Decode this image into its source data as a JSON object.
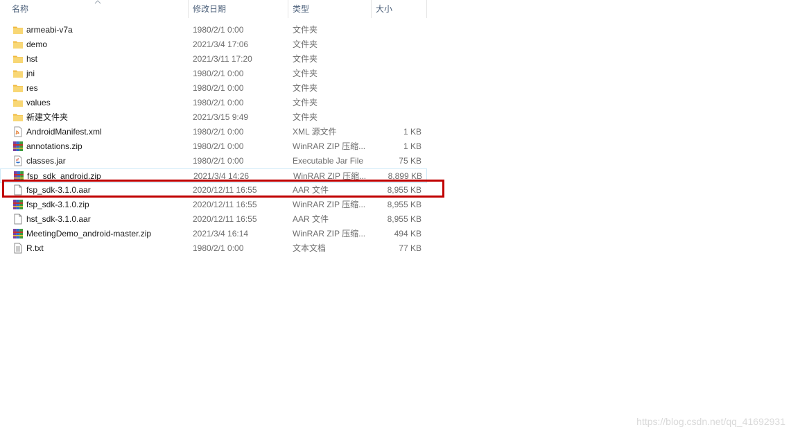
{
  "columns": {
    "name": "名称",
    "date": "修改日期",
    "type": "类型",
    "size": "大小"
  },
  "files": [
    {
      "icon": "folder-icon",
      "name": "armeabi-v7a",
      "date": "1980/2/1 0:00",
      "type": "文件夹",
      "size": ""
    },
    {
      "icon": "folder-icon",
      "name": "demo",
      "date": "2021/3/4 17:06",
      "type": "文件夹",
      "size": ""
    },
    {
      "icon": "folder-icon",
      "name": "hst",
      "date": "2021/3/11 17:20",
      "type": "文件夹",
      "size": ""
    },
    {
      "icon": "folder-icon",
      "name": "jni",
      "date": "1980/2/1 0:00",
      "type": "文件夹",
      "size": ""
    },
    {
      "icon": "folder-icon",
      "name": "res",
      "date": "1980/2/1 0:00",
      "type": "文件夹",
      "size": ""
    },
    {
      "icon": "folder-icon",
      "name": "values",
      "date": "1980/2/1 0:00",
      "type": "文件夹",
      "size": ""
    },
    {
      "icon": "folder-icon",
      "name": "新建文件夹",
      "date": "2021/3/15 9:49",
      "type": "文件夹",
      "size": ""
    },
    {
      "icon": "xml-file-icon",
      "name": "AndroidManifest.xml",
      "date": "1980/2/1 0:00",
      "type": "XML 源文件",
      "size": "1 KB"
    },
    {
      "icon": "winrar-archive-icon",
      "name": "annotations.zip",
      "date": "1980/2/1 0:00",
      "type": "WinRAR ZIP 压缩...",
      "size": "1 KB"
    },
    {
      "icon": "jar-file-icon",
      "name": "classes.jar",
      "date": "1980/2/1 0:00",
      "type": "Executable Jar File",
      "size": "75 KB"
    },
    {
      "icon": "winrar-archive-icon",
      "name": "fsp_sdk_android.zip",
      "date": "2021/3/4 14:26",
      "type": "WinRAR ZIP 压缩...",
      "size": "8,899 KB"
    },
    {
      "icon": "blank-file-icon",
      "name": "fsp_sdk-3.1.0.aar",
      "date": "2020/12/11 16:55",
      "type": "AAR 文件",
      "size": "8,955 KB"
    },
    {
      "icon": "winrar-archive-icon",
      "name": "fsp_sdk-3.1.0.zip",
      "date": "2020/12/11 16:55",
      "type": "WinRAR ZIP 压缩...",
      "size": "8,955 KB"
    },
    {
      "icon": "blank-file-icon",
      "name": "hst_sdk-3.1.0.aar",
      "date": "2020/12/11 16:55",
      "type": "AAR 文件",
      "size": "8,955 KB"
    },
    {
      "icon": "winrar-archive-icon",
      "name": "MeetingDemo_android-master.zip",
      "date": "2021/3/4 16:14",
      "type": "WinRAR ZIP 压缩...",
      "size": "494 KB"
    },
    {
      "icon": "text-file-icon",
      "name": "R.txt",
      "date": "1980/2/1 0:00",
      "type": "文本文档",
      "size": "77 KB"
    }
  ],
  "watermark": "https://blog.csdn.net/qq_41692931",
  "colors": {
    "highlight_box": "#c00000",
    "folder": "#f5c95a",
    "header_text": "#4c607a"
  }
}
